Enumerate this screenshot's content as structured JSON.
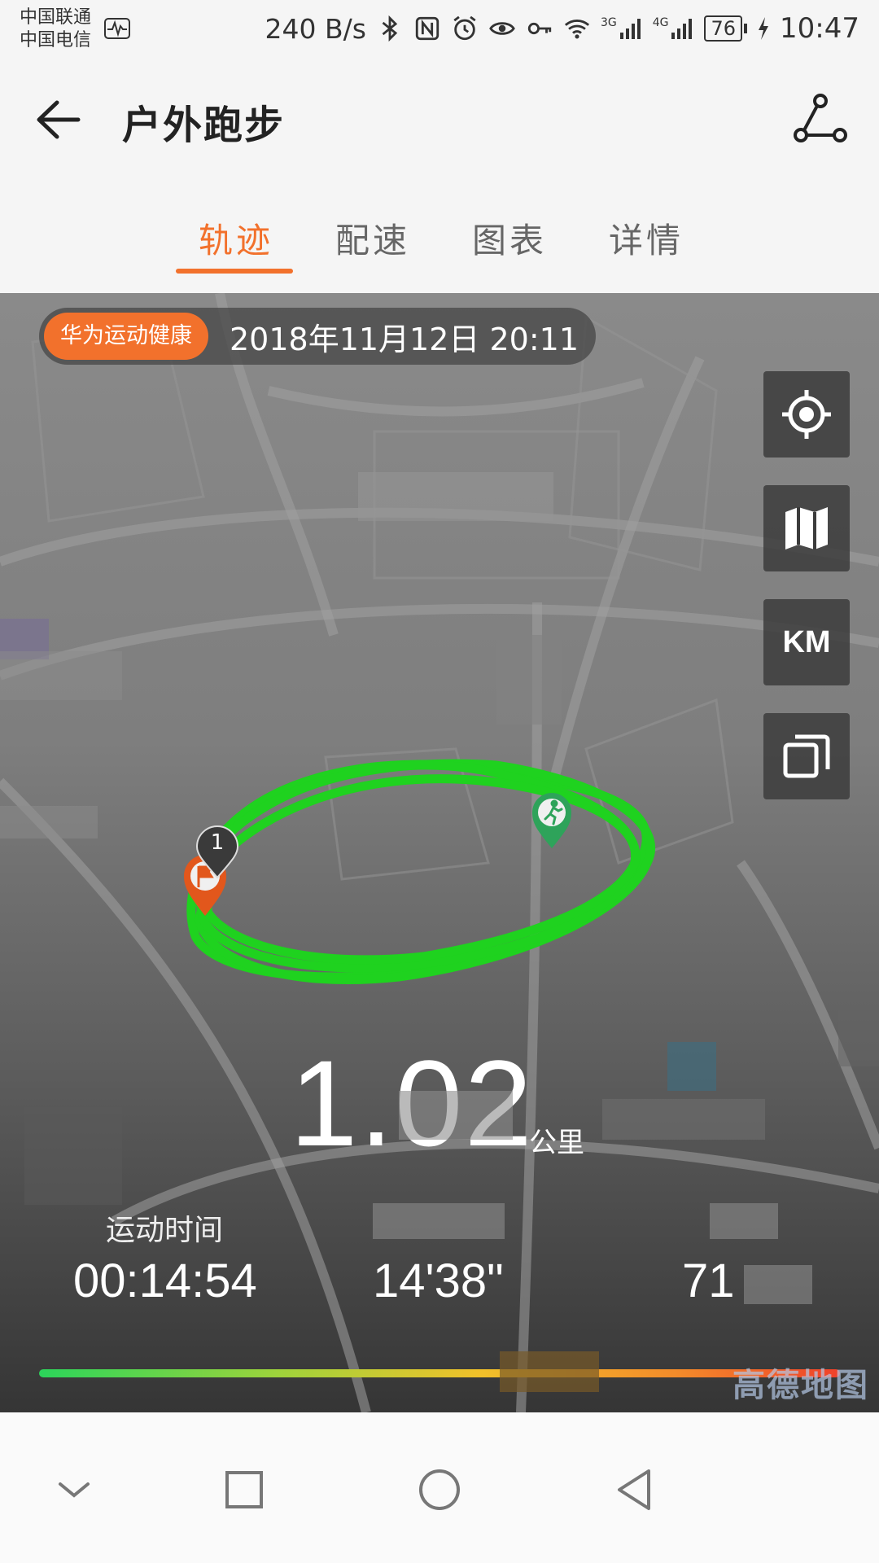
{
  "status_bar": {
    "carrier_1": "中国联通",
    "carrier_2": "中国电信",
    "net_speed": "240 B/s",
    "network_3g": "3G",
    "network_4g": "4G",
    "battery": "76",
    "time": "10:47",
    "icons": [
      "activity-icon",
      "bluetooth-icon",
      "nfc-icon",
      "alarm-icon",
      "eye-icon",
      "key-icon",
      "wifi-icon",
      "signal-3g-icon",
      "signal-4g-icon",
      "battery-icon",
      "charging-icon"
    ]
  },
  "header": {
    "title": "户外跑步",
    "icons": [
      "back-arrow-icon",
      "route-icon"
    ]
  },
  "tabs": [
    {
      "label": "轨迹",
      "active": true
    },
    {
      "label": "配速",
      "active": false
    },
    {
      "label": "图表",
      "active": false
    },
    {
      "label": "详情",
      "active": false
    }
  ],
  "map": {
    "brand": "华为运动健康",
    "datetime": "2018年11月12日 20:11",
    "side_buttons": {
      "locate_icon": "crosshair-icon",
      "map_icon": "map-icon",
      "unit_label": "KM",
      "layers_icon": "layers-icon"
    },
    "markers": {
      "start_icon": "flag-icon",
      "km_marker": "1",
      "end_icon": "runner-icon"
    },
    "credit": "高德地图"
  },
  "stats": {
    "distance": "1.02",
    "distance_unit": "公里",
    "duration_label": "运动时间",
    "duration_value": "00:14:54",
    "pace_value": "14'38\"",
    "third_value": "71"
  },
  "colors": {
    "accent": "#f2712c",
    "track": "#1fd21f",
    "pace_gradient": [
      "#2bd45a",
      "#f1c12a",
      "#f0402a"
    ]
  },
  "nav_bar": {
    "icons": [
      "chevron-down-icon",
      "recents-square-icon",
      "home-circle-icon",
      "back-triangle-icon"
    ]
  }
}
